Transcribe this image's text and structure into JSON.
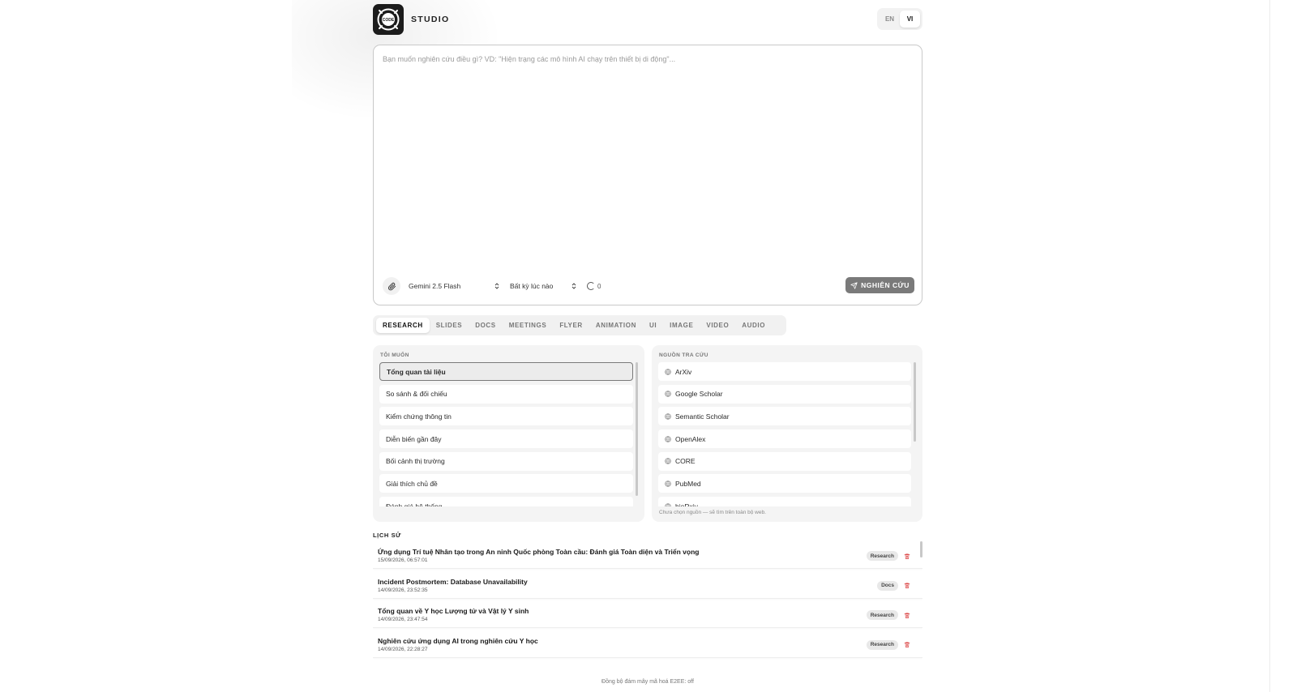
{
  "header": {
    "logo_text": "CODE",
    "brand": "STUDIO",
    "languages": [
      {
        "label": "EN",
        "active": false
      },
      {
        "label": "VI",
        "active": true
      }
    ]
  },
  "prompt": {
    "placeholder": "Bạn muốn nghiên cứu điều gì? VD: \"Hiện trạng các mô hình AI chạy trên thiết bị di động\"...",
    "value": "",
    "model": "Gemini 2.5 Flash",
    "time_range": "Bất kỳ lúc nào",
    "status_count": "0",
    "submit_label": "NGHIÊN CỨU"
  },
  "tabs": [
    {
      "label": "RESEARCH",
      "active": true
    },
    {
      "label": "SLIDES",
      "active": false
    },
    {
      "label": "DOCS",
      "active": false
    },
    {
      "label": "MEETINGS",
      "active": false
    },
    {
      "label": "FLYER",
      "active": false
    },
    {
      "label": "ANIMATION",
      "active": false
    },
    {
      "label": "UI",
      "active": false
    },
    {
      "label": "IMAGE",
      "active": false
    },
    {
      "label": "VIDEO",
      "active": false
    },
    {
      "label": "AUDIO",
      "active": false
    }
  ],
  "goals": {
    "label": "TÔI MUỐN",
    "items": [
      {
        "label": "Tổng quan tài liệu",
        "selected": true
      },
      {
        "label": "So sánh & đối chiếu",
        "selected": false
      },
      {
        "label": "Kiểm chứng thông tin",
        "selected": false
      },
      {
        "label": "Diễn biến gần đây",
        "selected": false
      },
      {
        "label": "Bối cảnh thị trường",
        "selected": false
      },
      {
        "label": "Giải thích chủ đề",
        "selected": false
      },
      {
        "label": "Đánh giá hệ thống",
        "selected": false
      }
    ]
  },
  "sources": {
    "label": "NGUỒN TRA CỨU",
    "items": [
      {
        "label": "ArXiv",
        "icon": "globe-icon"
      },
      {
        "label": "Google Scholar",
        "icon": "globe-icon"
      },
      {
        "label": "Semantic Scholar",
        "icon": "globe-icon"
      },
      {
        "label": "OpenAlex",
        "icon": "globe-icon"
      },
      {
        "label": "CORE",
        "icon": "globe-icon"
      },
      {
        "label": "PubMed",
        "icon": "globe-icon"
      },
      {
        "label": "bioRxiv",
        "icon": "globe-icon"
      }
    ],
    "hint": "Chưa chọn nguồn — sẽ tìm trên toàn bộ web."
  },
  "history": {
    "title": "LỊCH SỬ",
    "items": [
      {
        "title": "Ứng dụng Trí tuệ Nhân tạo trong An ninh Quốc phòng Toàn cầu: Đánh giá Toàn diện và Triển vọng",
        "date": "15/09/2026, 06:57:01",
        "badge": "Research"
      },
      {
        "title": "Incident Postmortem: Database Unavailability",
        "date": "14/09/2026, 23:52:35",
        "badge": "Docs"
      },
      {
        "title": "Tổng quan về Y học Lượng tử và Vật lý Y sinh",
        "date": "14/09/2026, 23:47:54",
        "badge": "Research"
      },
      {
        "title": "Nghiên cứu ứng dụng AI trong nghiên cứu Y học",
        "date": "14/09/2026, 22:28:27",
        "badge": "Research"
      }
    ]
  },
  "footer": {
    "text": "Đồng bộ đám mây mã hoá E2EE: off"
  },
  "colors": {
    "delete_icon": "#d93a3a",
    "submit_bg": "#7a7a7a",
    "panel_bg": "#f4f4f4"
  }
}
